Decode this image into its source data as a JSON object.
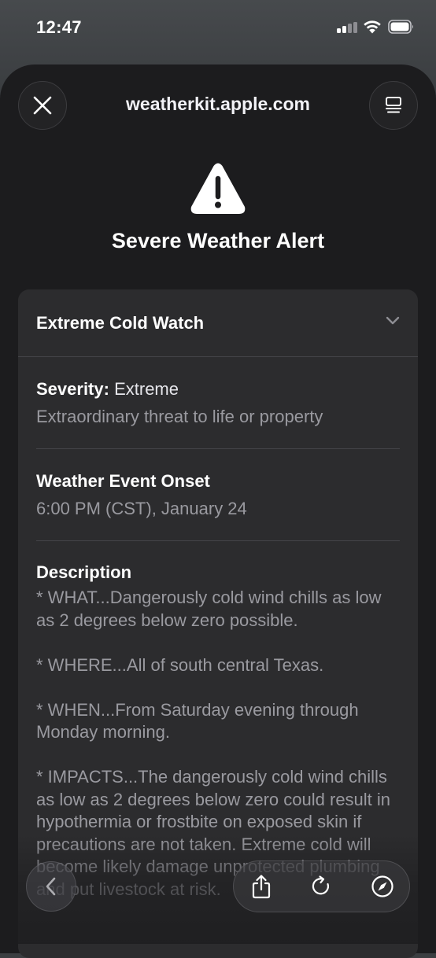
{
  "status_bar": {
    "time": "12:47",
    "signal_icon": "cellular-signal-icon",
    "wifi_icon": "wifi-icon",
    "battery_icon": "battery-icon"
  },
  "header": {
    "url": "weatherkit.apple.com",
    "close_icon": "close-icon",
    "reader_icon": "reader-mode-icon"
  },
  "alert": {
    "icon": "warning-triangle-icon",
    "title": "Severe Weather Alert"
  },
  "card": {
    "event_title": "Extreme Cold Watch",
    "chevron_icon": "chevron-down-icon",
    "severity": {
      "label": "Severity:",
      "value": "Extreme",
      "text": "Extraordinary threat to life or property"
    },
    "onset": {
      "label": "Weather Event Onset",
      "value": "6:00 PM (CST), January 24"
    },
    "description": {
      "label": "Description",
      "paragraphs": [
        "* WHAT...Dangerously cold wind chills as low as 2 degrees below zero possible.",
        "* WHERE...All of south central Texas.",
        "* WHEN...From Saturday evening through Monday morning.",
        "* IMPACTS...The dangerously cold wind chills as low as 2 degrees below zero could result in hypothermia or frostbite on exposed skin if precautions are not taken. Extreme cold will become likely damage unprotected plumbing and put livestock at risk."
      ]
    }
  },
  "toolbar": {
    "back_icon": "chevron-left-icon",
    "share_icon": "share-icon",
    "reload_icon": "reload-icon",
    "safari_icon": "compass-icon"
  },
  "colors": {
    "sheet_bg": "#1c1c1e",
    "card_bg": "#2c2c2e",
    "secondary_text": "#9a9aa0"
  }
}
